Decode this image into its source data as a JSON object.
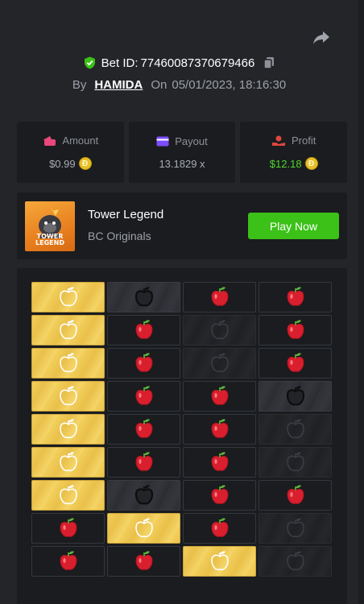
{
  "bet": {
    "label": "Bet ID:",
    "id": "77460087370679466",
    "by_label": "By",
    "user": "HAMIDA",
    "on_label": "On",
    "datetime": "05/01/2023, 18:16:30"
  },
  "stats": {
    "amount": {
      "label": "Amount",
      "value": "$0.99",
      "icon": "wallet-icon",
      "color": "#e8487a"
    },
    "payout": {
      "label": "Payout",
      "value": "13.1829 x",
      "icon": "card-icon",
      "color": "#7c4dff"
    },
    "profit": {
      "label": "Profit",
      "value": "$12.18",
      "icon": "hand-coin-icon",
      "color": "#e0463e"
    }
  },
  "game": {
    "title": "Tower Legend",
    "subtitle": "BC Originals",
    "thumb_text_1": "TOWER",
    "thumb_text_2": "LEGEND",
    "play_label": "Play Now"
  },
  "coin_symbol": "Ð",
  "colors": {
    "accent_green": "#3bc117",
    "safe_gold": "#f2cf5b",
    "apple_red": "#d91f2e",
    "background": "#232529",
    "panel": "#1a1c1f"
  },
  "board": {
    "rows": [
      [
        "safe",
        "bad",
        "apple",
        "apple"
      ],
      [
        "safe",
        "apple",
        "dim",
        "apple"
      ],
      [
        "safe",
        "apple",
        "dim",
        "apple"
      ],
      [
        "safe",
        "apple",
        "apple",
        "bad"
      ],
      [
        "safe",
        "apple",
        "apple",
        "dim"
      ],
      [
        "safe",
        "apple",
        "apple",
        "dim"
      ],
      [
        "safe",
        "bad",
        "apple",
        "apple"
      ],
      [
        "apple",
        "safe",
        "apple",
        "dim"
      ],
      [
        "apple",
        "apple",
        "safe",
        "dim"
      ]
    ]
  }
}
